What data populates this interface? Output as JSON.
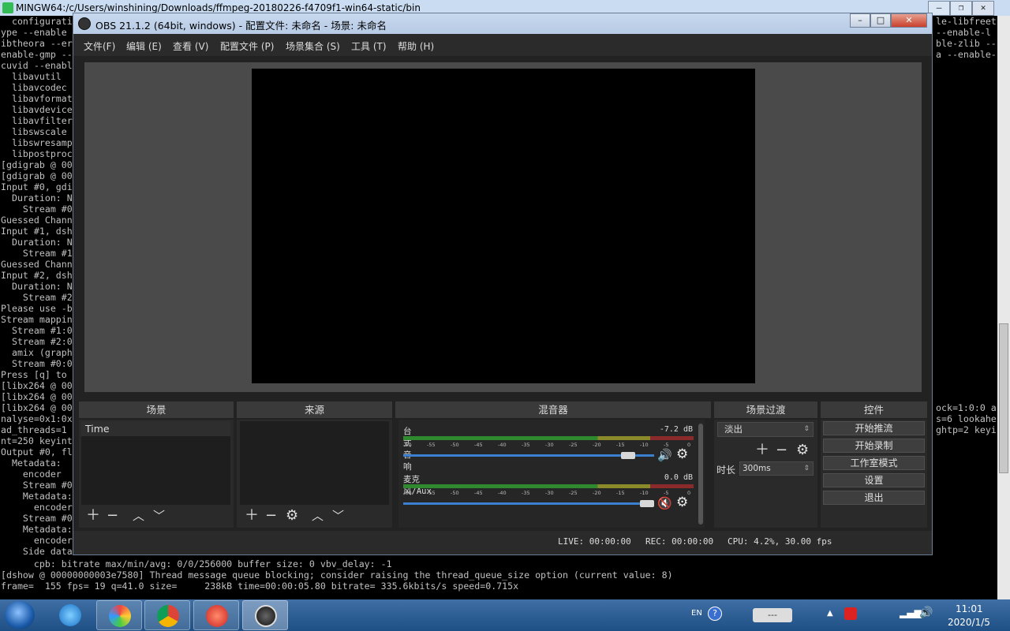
{
  "terminal": {
    "title": "MINGW64:/c/Users/winshining/Downloads/ffmpeg-20180226-f4709f1-win64-static/bin",
    "left_lines": [
      "  configurati",
      "ype --enable",
      "ibtheora --er",
      "enable-gmp --",
      "cuvid --enabl",
      "  libavutil",
      "  libavcodec",
      "  libavformat",
      "  libavdevice",
      "  libavfilter",
      "  libswscale",
      "  libswresamp",
      "  libpostproc",
      "[gdigrab @ 00",
      "[gdigrab @ 00",
      "Input #0, gdi",
      "  Duration: N",
      "    Stream #0",
      "Guessed Chann",
      "Input #1, dsh",
      "  Duration: N",
      "    Stream #1",
      "Guessed Chann",
      "Input #2, dsh",
      "  Duration: N",
      "    Stream #2",
      "Please use -b",
      "Stream mappin",
      "  Stream #1:0",
      "  Stream #2:0",
      "  amix (graph",
      "  Stream #0:0",
      "Press [q] to",
      "[libx264 @ 00",
      "[libx264 @ 00",
      "[libx264 @ 00",
      "nalyse=0x1:0x",
      "ad_threads=1",
      "nt=250 keyint",
      "Output #0, fl",
      "  Metadata:",
      "    encoder",
      "    Stream #0",
      "    Metadata:",
      "      encoder",
      "    Stream #0",
      "    Metadata:",
      "      encoder",
      "    Side data"
    ],
    "right_lines": [
      {
        "row": 0,
        "text": "le-libfreet"
      },
      {
        "row": 1,
        "text": "--enable-l"
      },
      {
        "row": 2,
        "text": "ble-zlib --"
      },
      {
        "row": 3,
        "text": "a --enable-"
      },
      {
        "row": 35,
        "text": "ock=1:0:0 a"
      },
      {
        "row": 36,
        "text": "s=6 lookahe"
      },
      {
        "row": 37,
        "text": "ghtp=2 keyi"
      }
    ],
    "bottom_lines": [
      "      cpb: bitrate max/min/avg: 0/0/256000 buffer size: 0 vbv_delay: -1",
      "[dshow @ 00000000003e7580] Thread message queue blocking; consider raising the thread_queue_size option (current value: 8)",
      "frame=  155 fps= 19 q=41.0 size=     238kB time=00:00:05.80 bitrate= 335.6kbits/s speed=0.715x"
    ]
  },
  "obs": {
    "title": "OBS 21.1.2 (64bit, windows) - 配置文件: 未命名 - 场景: 未命名",
    "menu": [
      "文件(F)",
      "编辑 (E)",
      "查看 (V)",
      "配置文件 (P)",
      "场景集合 (S)",
      "工具 (T)",
      "帮助 (H)"
    ],
    "docks": {
      "scenes": "场景",
      "sources": "来源",
      "mixer": "混音器",
      "transitions": "场景过渡",
      "controls": "控件"
    },
    "scene_items": [
      "Time"
    ],
    "mixer": {
      "ticks": [
        "-60",
        "-55",
        "-50",
        "-45",
        "-40",
        "-35",
        "-30",
        "-25",
        "-20",
        "-15",
        "-10",
        "-5",
        "0"
      ],
      "channels": [
        {
          "name": "台式音响",
          "db": "-7.2 dB",
          "volume": 0.92,
          "muted": false
        },
        {
          "name": "麦克风/Aux",
          "db": "0.0 dB",
          "volume": 1.0,
          "muted": true
        }
      ]
    },
    "transition": {
      "selected": "淡出",
      "duration_label": "时长",
      "duration_value": "300ms"
    },
    "controls": [
      "开始推流",
      "开始录制",
      "工作室模式",
      "设置",
      "退出"
    ],
    "status": {
      "live": "LIVE: 00:00:00",
      "rec": "REC: 00:00:00",
      "cpu": "CPU: 4.2%, 30.00 fps"
    }
  },
  "taskbar": {
    "lang": "EN",
    "time": "11:01",
    "date": "2020/1/5",
    "input_box": "---"
  },
  "colors": {
    "meter_green": "#2f8a2f",
    "meter_yellow": "#8a8a2a",
    "meter_red": "#8a2a2a",
    "volume_blue": "#3a80d0",
    "mute_red": "#e03030"
  }
}
